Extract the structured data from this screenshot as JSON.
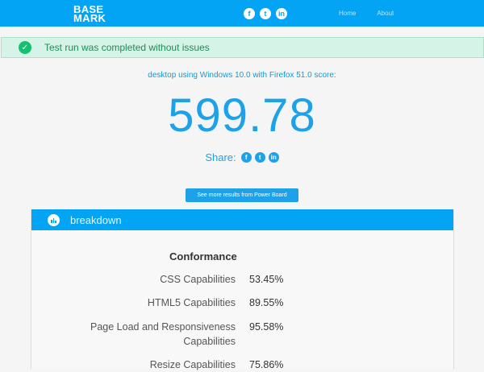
{
  "header": {
    "logo_line1": "BASE",
    "logo_line2": "MARK",
    "social": [
      {
        "icon": "facebook-icon",
        "glyph": "f"
      },
      {
        "icon": "twitter-icon",
        "glyph": "t"
      },
      {
        "icon": "linkedin-icon",
        "glyph": "in"
      }
    ],
    "nav": [
      "Home",
      "About"
    ]
  },
  "alert": {
    "icon": "check-circle-icon",
    "text": "Test run was completed without issues"
  },
  "result": {
    "label": "desktop using Windows 10.0 with Firefox 51.0 score:",
    "score": "599.78",
    "share_label": "Share:"
  },
  "powerboard_button": "See more results from Power Board",
  "breakdown": {
    "title": "breakdown",
    "section_title": "Conformance",
    "rows": [
      {
        "label": "CSS Capabilities",
        "value": "53.45%"
      },
      {
        "label": "HTML5 Capabilities",
        "value": "89.55%"
      },
      {
        "label": "Page Load and Responsiveness Capabilities",
        "label_line1": "Page Load and Responsiveness",
        "label_line2": "Capabilities",
        "value": "95.58%"
      },
      {
        "label": "Resize Capabilities",
        "value": "75.86%"
      }
    ]
  },
  "colors": {
    "primary": "#03a4f4",
    "success_bg": "#d5f3e6",
    "success_icon": "#12c271",
    "score": "#1da2e9"
  }
}
